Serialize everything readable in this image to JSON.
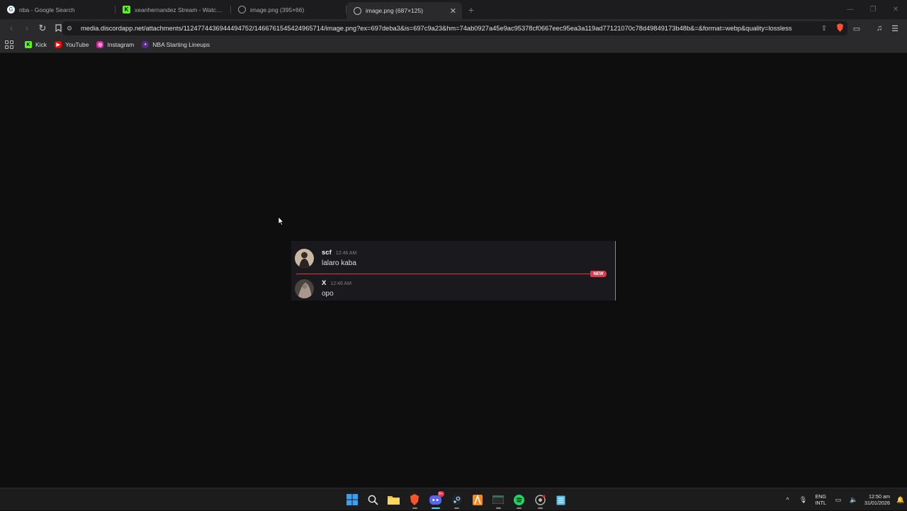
{
  "tabs": [
    {
      "title": "nba - Google Search",
      "icon": "google-icon",
      "active": false
    },
    {
      "title": "xeanhernandez Stream - Watch Live",
      "icon": "kick-icon",
      "active": false
    },
    {
      "title": "image.png (395×66)",
      "icon": "globe-icon",
      "active": false
    },
    {
      "title": "image.png (687×125)",
      "icon": "globe-icon",
      "active": true
    }
  ],
  "address": {
    "url": "media.discordapp.net/attachments/1124774436944494752/1466761545424965714/image.png?ex=697deba3&is=697c9a23&hm=74ab0927a45e9ac95378cf0667eec95ea3a119ad77121070c78d49849173b48b&=&format=webp&quality=lossless"
  },
  "bookmarks": [
    {
      "label": "Kick",
      "icon": "kick-icon"
    },
    {
      "label": "YouTube",
      "icon": "youtube-icon"
    },
    {
      "label": "Instagram",
      "icon": "instagram-icon"
    },
    {
      "label": "NBA Starting Lineups",
      "icon": "nba-icon"
    }
  ],
  "chat": {
    "messages": [
      {
        "username": "scf",
        "time": "12:46 AM",
        "text": "lalaro kaba"
      },
      {
        "username": "X",
        "time": "12:46 AM",
        "text": "opo"
      }
    ],
    "new_label": "NEW",
    "new_color": "#e2374a"
  },
  "taskbar": {
    "discord_badge": "9+",
    "lang_line1": "ENG",
    "lang_line2": "INTL",
    "time": "12:50 am",
    "date": "31/01/2026"
  }
}
